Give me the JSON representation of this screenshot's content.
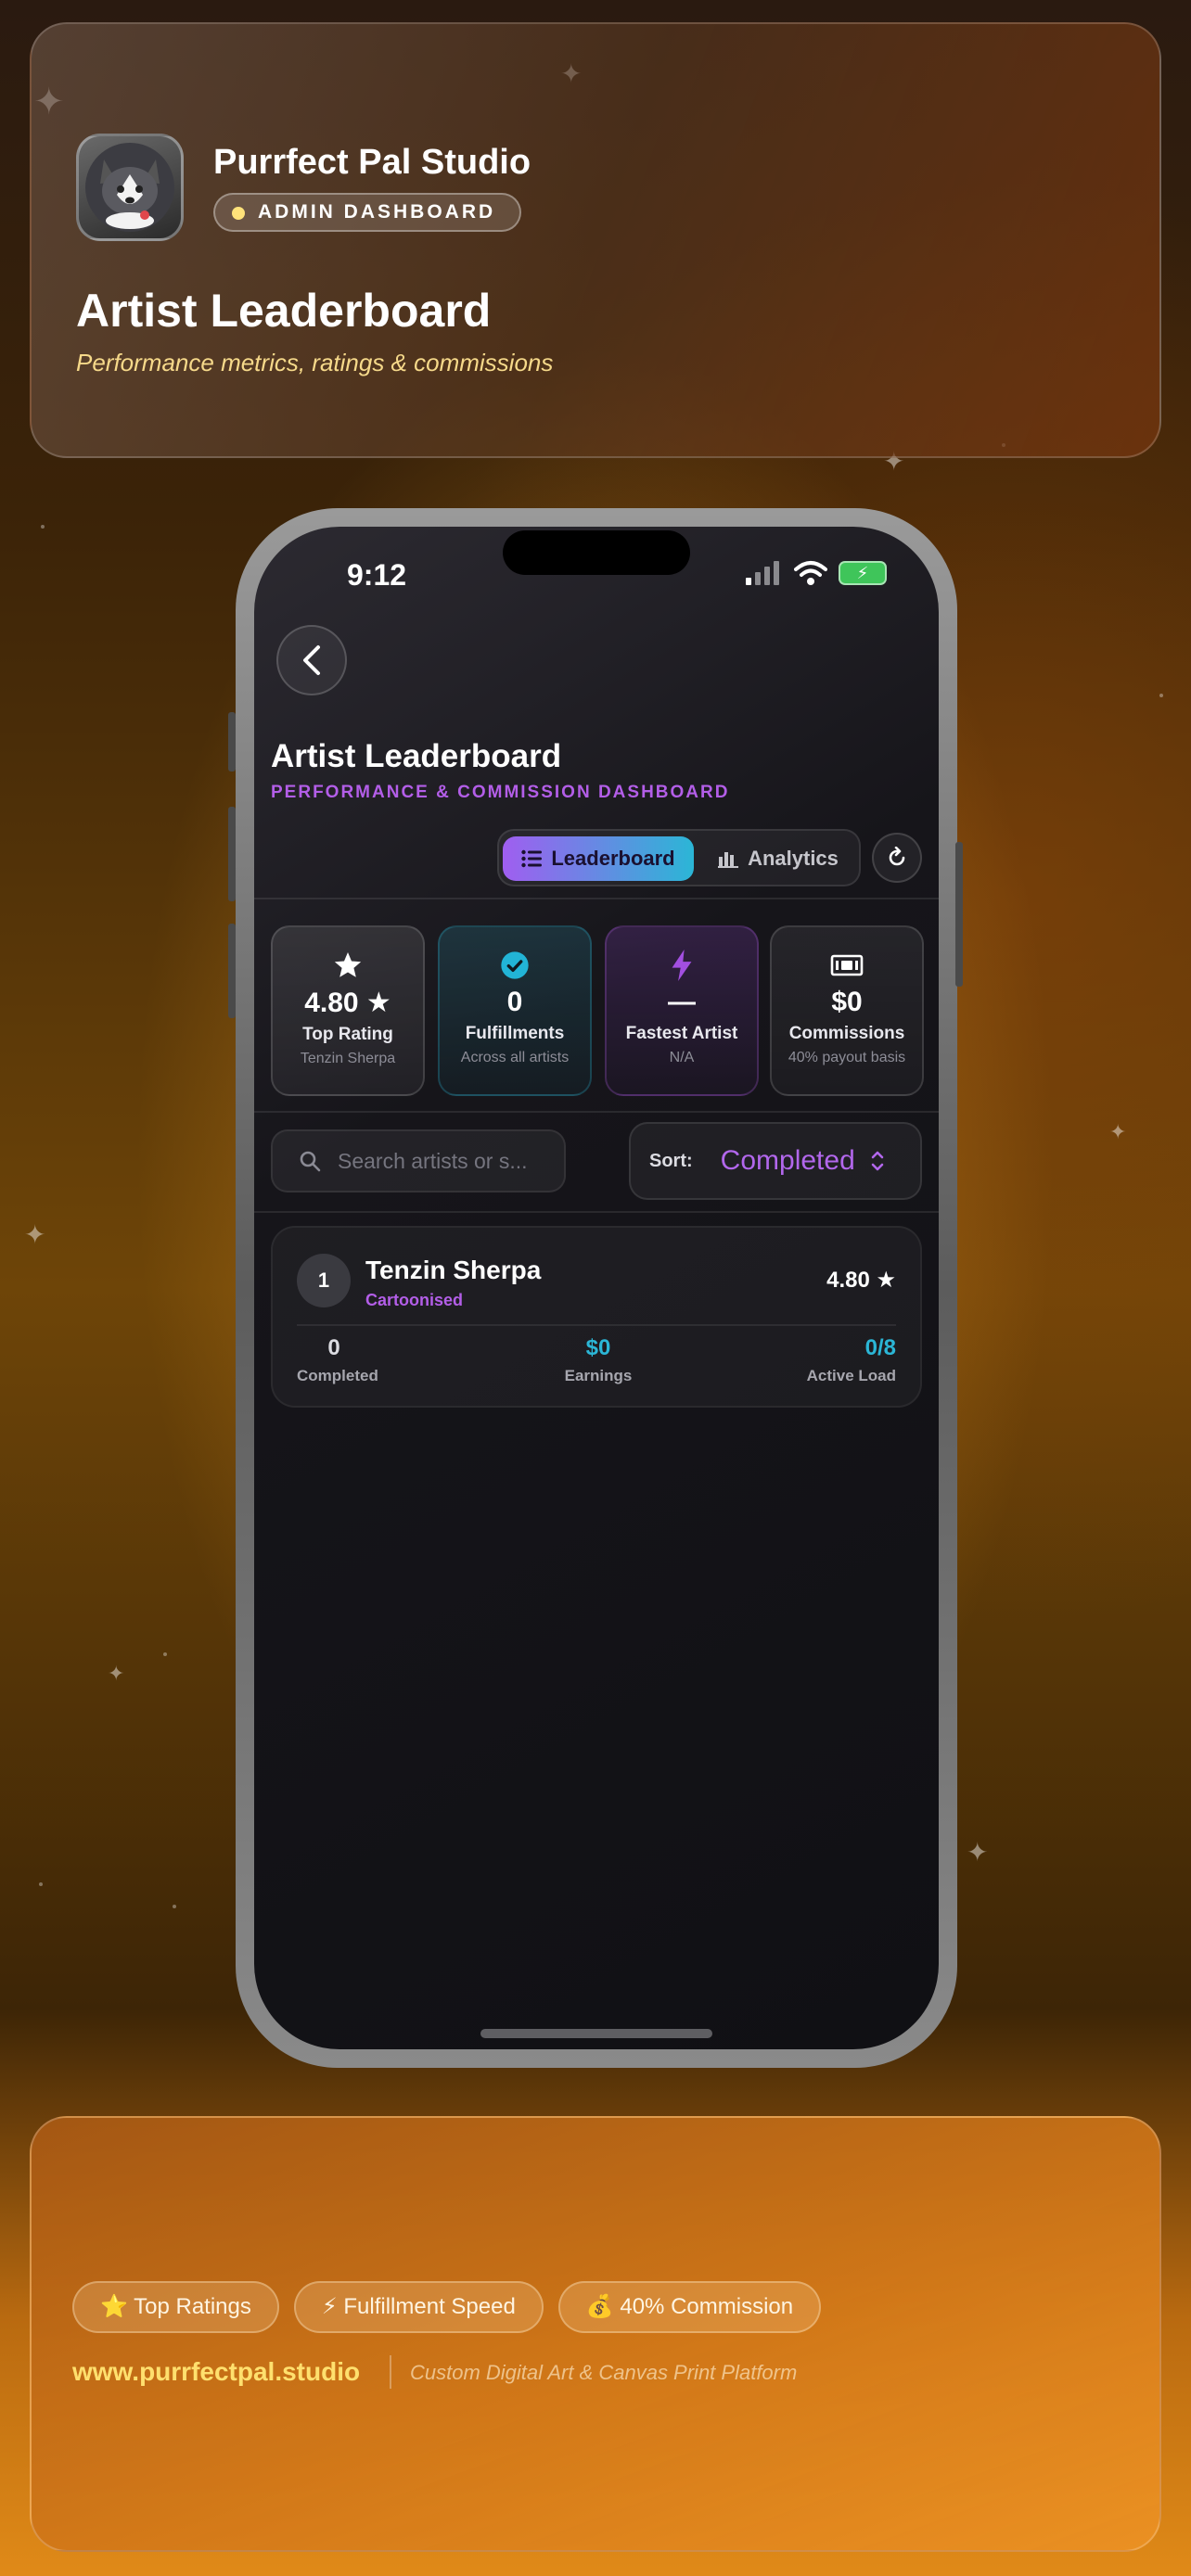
{
  "header": {
    "studio_name": "Purrfect Pal Studio",
    "badge": "ADMIN DASHBOARD",
    "title": "Artist Leaderboard",
    "subtitle": "Performance metrics, ratings & commissions"
  },
  "status_bar": {
    "time": "9:12"
  },
  "screen": {
    "title": "Artist Leaderboard",
    "subtitle": "PERFORMANCE & COMMISSION DASHBOARD",
    "tabs": [
      {
        "label": "Leaderboard",
        "icon": "list-icon",
        "active": true
      },
      {
        "label": "Analytics",
        "icon": "bar-chart-icon",
        "active": false
      }
    ]
  },
  "stats": [
    {
      "icon": "star-icon",
      "value": "4.80 ★",
      "label": "Top Rating",
      "note": "Tenzin Sherpa"
    },
    {
      "icon": "check-circle-icon",
      "value": "0",
      "label": "Fulfillments",
      "note": "Across all artists"
    },
    {
      "icon": "lightning-icon",
      "value": "—",
      "label": "Fastest Artist",
      "note": "N/A"
    },
    {
      "icon": "cash-icon",
      "value": "$0",
      "label": "Commissions",
      "note": "40% payout basis"
    }
  ],
  "search": {
    "placeholder": "Search artists or s...",
    "value": ""
  },
  "sort": {
    "label": "Sort:",
    "value": "Completed"
  },
  "artists": [
    {
      "rank": "1",
      "name": "Tenzin Sherpa",
      "style": "Cartoonised",
      "rating": "4.80 ★",
      "completed": "0",
      "completed_label": "Completed",
      "earnings": "$0",
      "earnings_label": "Earnings",
      "active_load": "0/8",
      "active_load_label": "Active Load"
    }
  ],
  "footer": {
    "pills": [
      "⭐ Top Ratings",
      "⚡ Fulfillment Speed",
      "💰 40% Commission"
    ],
    "url": "www.purrfectpal.studio",
    "tagline": "Custom Digital Art & Canvas Print Platform"
  },
  "colors": {
    "accent_purple": "#b35ee8",
    "accent_cyan": "#2bb6d6",
    "gold": "#ffe06e"
  }
}
